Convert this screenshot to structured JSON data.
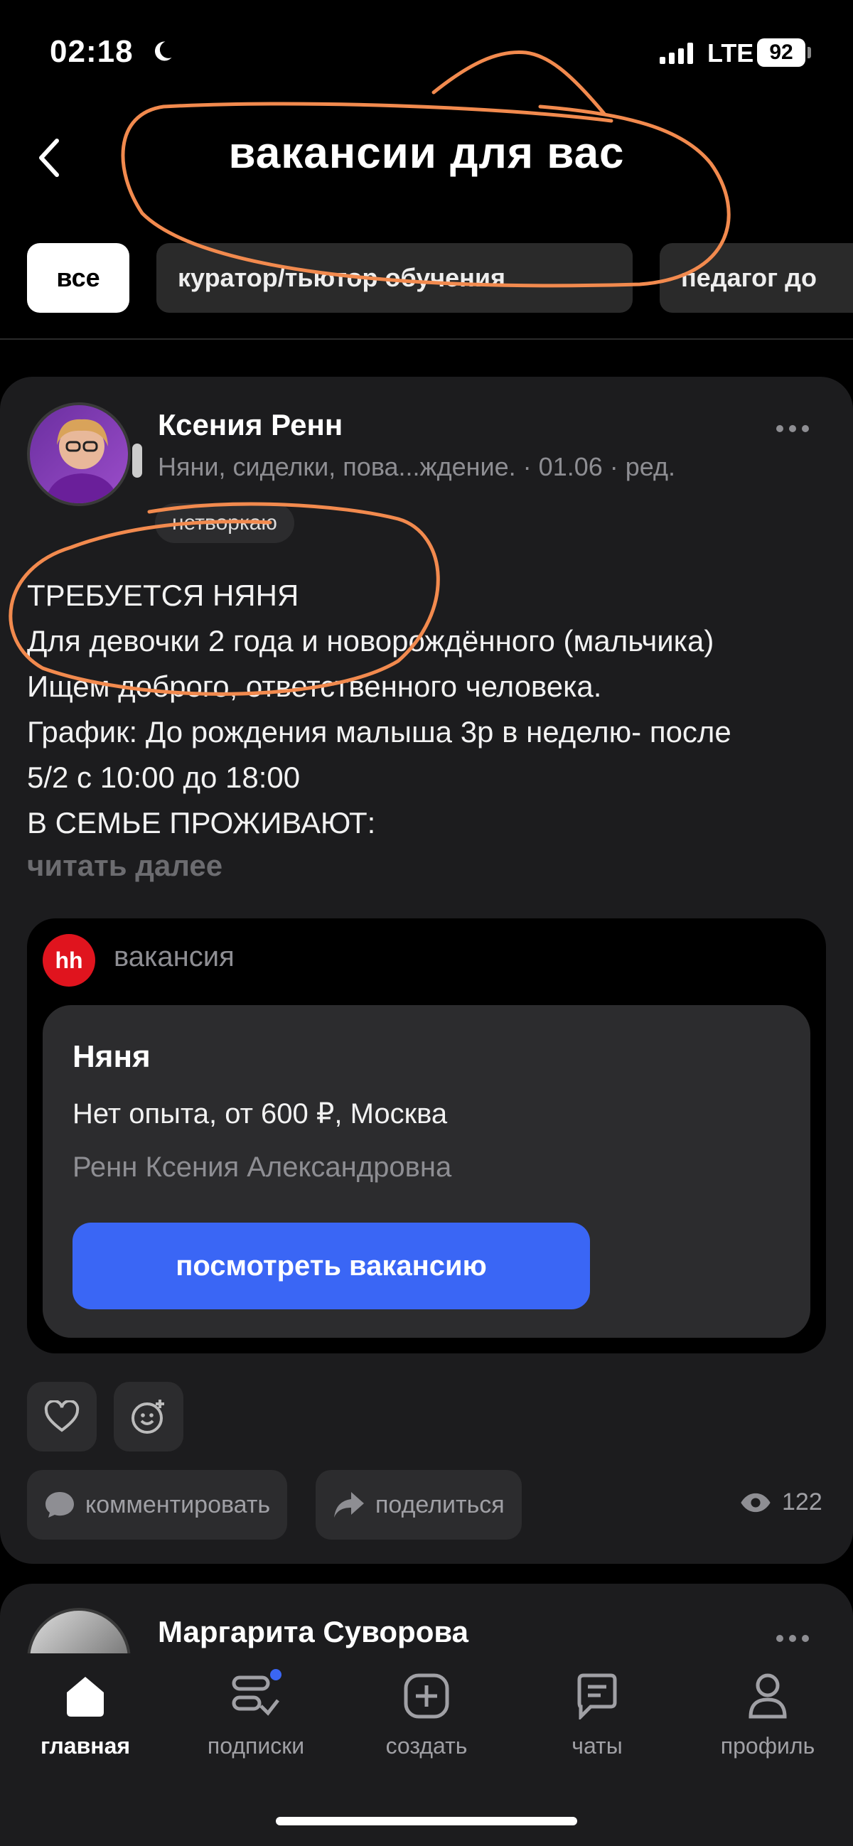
{
  "status_bar": {
    "time": "02:18",
    "network": "LTE",
    "battery": "92"
  },
  "header": {
    "title": "вакансии для вас"
  },
  "chips": [
    {
      "label": "все",
      "active": true
    },
    {
      "label": "куратор/тьютор обучения",
      "active": false
    },
    {
      "label": "педагог до",
      "active": false
    }
  ],
  "post": {
    "author": "Ксения Ренн",
    "meta": "Няни, сиделки, пова...ждение. · 01.06 · ред.",
    "badge": "нетворкаю",
    "text": "ТРЕБУЕТСЯ НЯНЯ\nДля девочки 2 года и новорождённого (мальчика)\nИщем доброго, ответственного человека.\nГрафик: До рождения малыша 3р в неделю- после\n5/2 с 10:00 до 18:00\n В СЕМЬЕ ПРОЖИВАЮТ:",
    "read_more": "читать далее",
    "embed": {
      "logo": "hh",
      "label": "вакансия",
      "title": "Няня",
      "info": "Нет опыта, от 600 ₽, Москва",
      "company": "Ренн Ксения Александровна",
      "button": "посмотреть вакансию"
    },
    "actions": {
      "comment": "комментировать",
      "share": "поделиться",
      "views": "122"
    }
  },
  "next_post": {
    "author": "Маргарита Суворова"
  },
  "tabbar": {
    "items": [
      {
        "label": "главная",
        "icon": "home-icon",
        "active": true
      },
      {
        "label": "подписки",
        "icon": "subscriptions-icon",
        "active": false
      },
      {
        "label": "создать",
        "icon": "plus-square-icon",
        "active": false
      },
      {
        "label": "чаты",
        "icon": "chat-icon",
        "active": false
      },
      {
        "label": "профиль",
        "icon": "profile-icon",
        "active": false
      }
    ]
  },
  "colors": {
    "accent": "#3a66f5",
    "annotation": "#f28a4e",
    "hh_red": "#e0141e"
  }
}
